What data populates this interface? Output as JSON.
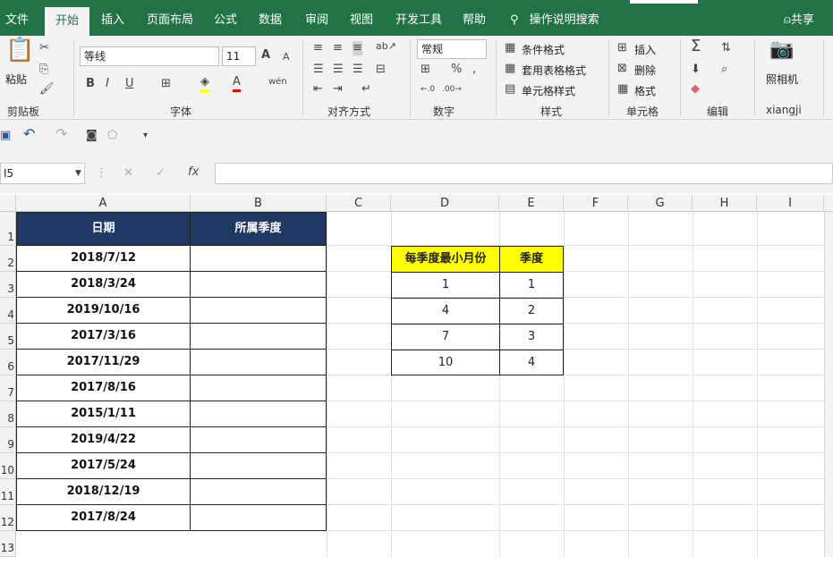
{
  "tabs": [
    "文件",
    "开始",
    "插入",
    "页面布局",
    "公式",
    "数据",
    "审阅",
    "视图",
    "开发工具",
    "帮助"
  ],
  "tell_me": "操作说明搜索",
  "share": "共享",
  "ribbon": {
    "clipboard": {
      "paste": "粘贴",
      "label": "剪贴板"
    },
    "font": {
      "name": "等线",
      "size": "11",
      "label": "字体",
      "bold": "B",
      "italic": "I",
      "underline": "U",
      "grow": "A",
      "shrink": "A",
      "color": "A",
      "phonetic": "wén"
    },
    "alignment": {
      "label": "对齐方式"
    },
    "number": {
      "format": "常规",
      "percent": "%",
      "comma": ",",
      "label": "数字"
    },
    "styles": {
      "conditional": "条件格式",
      "table": "套用表格格式",
      "cell": "单元格样式",
      "label": "样式"
    },
    "cells": {
      "insert": "插入",
      "delete": "删除",
      "format": "格式",
      "label": "单元格"
    },
    "editing": {
      "label": "编辑"
    },
    "camera": {
      "name": "照相机",
      "label": "xiangji"
    }
  },
  "namebox": "I5",
  "fx": "fx",
  "columns": [
    "A",
    "B",
    "C",
    "D",
    "E",
    "F",
    "G",
    "H",
    "I"
  ],
  "rows": [
    "1",
    "2",
    "3",
    "4",
    "5",
    "6",
    "7",
    "8",
    "9",
    "10",
    "11",
    "12",
    "13"
  ],
  "table1": {
    "headers": [
      "日期",
      "所属季度"
    ],
    "dates": [
      "2018/7/12",
      "2018/3/24",
      "2019/10/16",
      "2017/3/16",
      "2017/11/29",
      "2017/8/16",
      "2015/1/11",
      "2019/4/22",
      "2017/5/24",
      "2018/12/19",
      "2017/8/24"
    ]
  },
  "table2": {
    "headers": [
      "每季度最小月份",
      "季度"
    ],
    "rows": [
      [
        "1",
        "1"
      ],
      [
        "4",
        "2"
      ],
      [
        "7",
        "3"
      ],
      [
        "10",
        "4"
      ]
    ]
  }
}
